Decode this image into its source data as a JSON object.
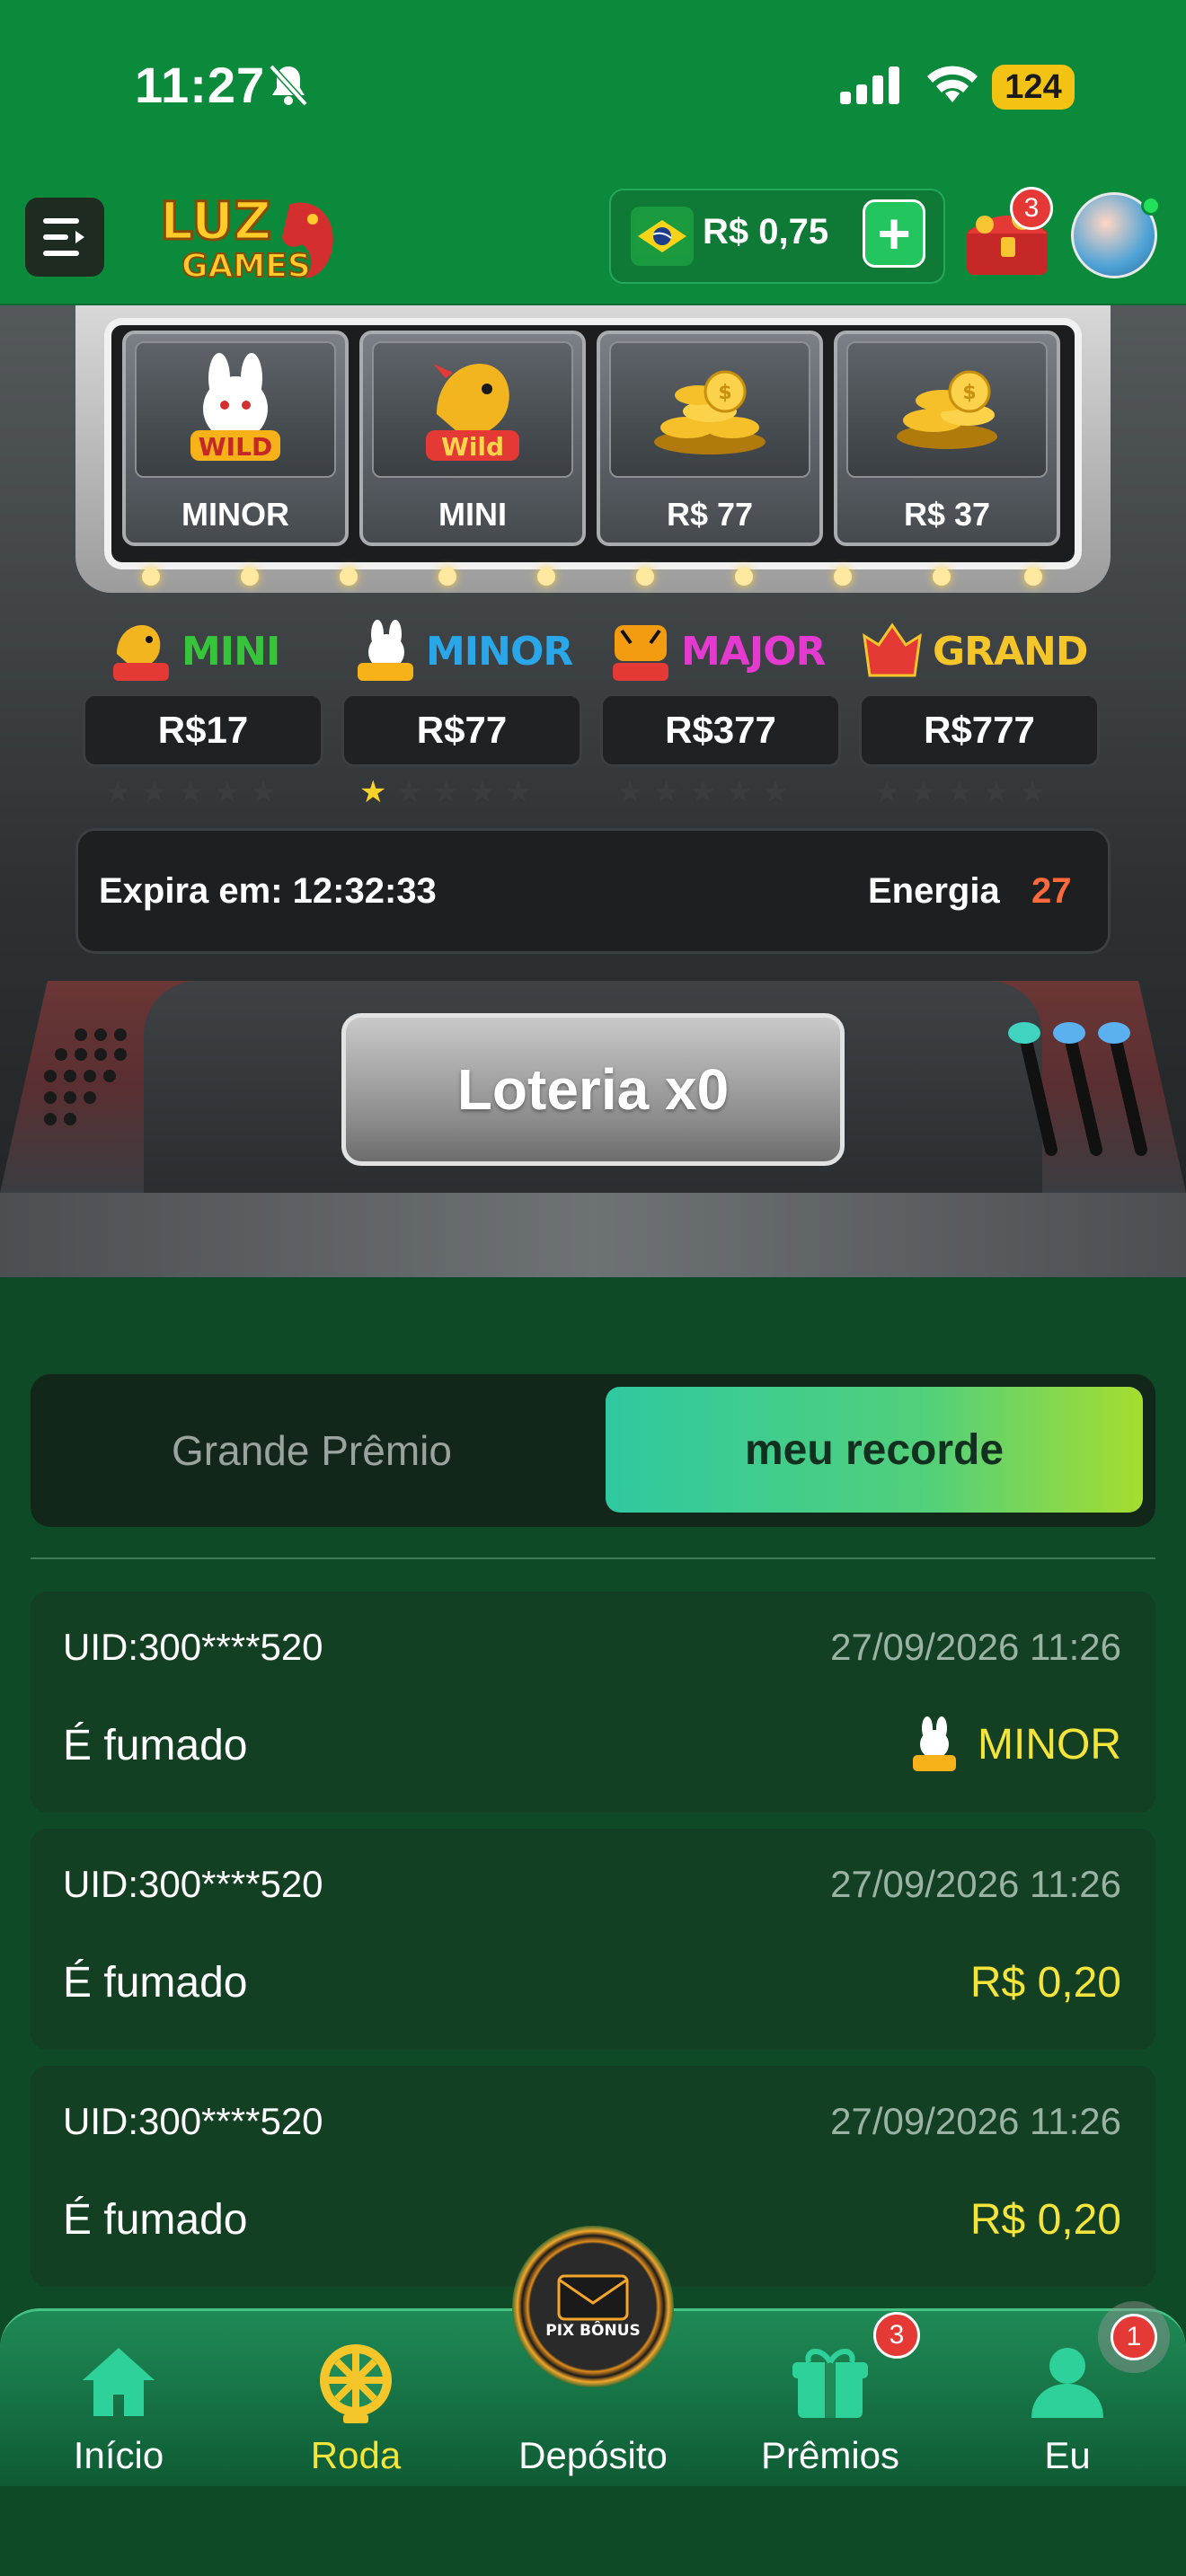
{
  "status_bar": {
    "time": "11:27",
    "battery": "124"
  },
  "header": {
    "logo_text_top": "LUZ",
    "logo_text_bottom": "GAMES",
    "balance": "R$ 0,75",
    "chest_badge": "3"
  },
  "reels": [
    {
      "label": "MINOR",
      "icon": "rabbit-wild-icon"
    },
    {
      "label": "MINI",
      "icon": "dragon-wild-icon"
    },
    {
      "label": "R$ 77",
      "icon": "gold-coins-icon"
    },
    {
      "label": "R$ 37",
      "icon": "gold-coins-icon"
    }
  ],
  "jackpots": [
    {
      "name": "MINI",
      "value": "R$17",
      "stars_on": 0,
      "color": "#35c43a",
      "icon": "dragon-wild-icon"
    },
    {
      "name": "MINOR",
      "value": "R$77",
      "stars_on": 1,
      "color": "#2aa7e8",
      "icon": "rabbit-wild-icon"
    },
    {
      "name": "MAJOR",
      "value": "R$377",
      "stars_on": 0,
      "color": "#e43ad0",
      "icon": "tiger-wild-icon"
    },
    {
      "name": "GRAND",
      "value": "R$777",
      "stars_on": 0,
      "color": "#f5c62a",
      "icon": "grand-win-icon"
    }
  ],
  "info": {
    "expira": "Expira em: 12:32:33",
    "energia_label": "Energia",
    "energia_value": "27"
  },
  "lottery_button": "Loteria x0",
  "tabs": {
    "grande": "Grande Prêmio",
    "recorde": "meu recorde",
    "active": "recorde"
  },
  "records": [
    {
      "uid": "UID:300****520",
      "date": "27/09/2026 11:26",
      "desc": "É fumado",
      "prize": "MINOR",
      "prize_icon": "rabbit-wild-icon"
    },
    {
      "uid": "UID:300****520",
      "date": "27/09/2026 11:26",
      "desc": "É fumado",
      "prize": "R$ 0,20"
    },
    {
      "uid": "UID:300****520",
      "date": "27/09/2026 11:26",
      "desc": "É fumado",
      "prize": "R$ 0,20"
    }
  ],
  "nav": {
    "inicio": "Início",
    "roda": "Roda",
    "deposito": "Depósito",
    "premios": "Prêmios",
    "eu": "Eu",
    "premios_badge": "3",
    "eu_badge": "1",
    "center_label": "PIX BÔNUS",
    "active_color": "#f5e43a"
  }
}
